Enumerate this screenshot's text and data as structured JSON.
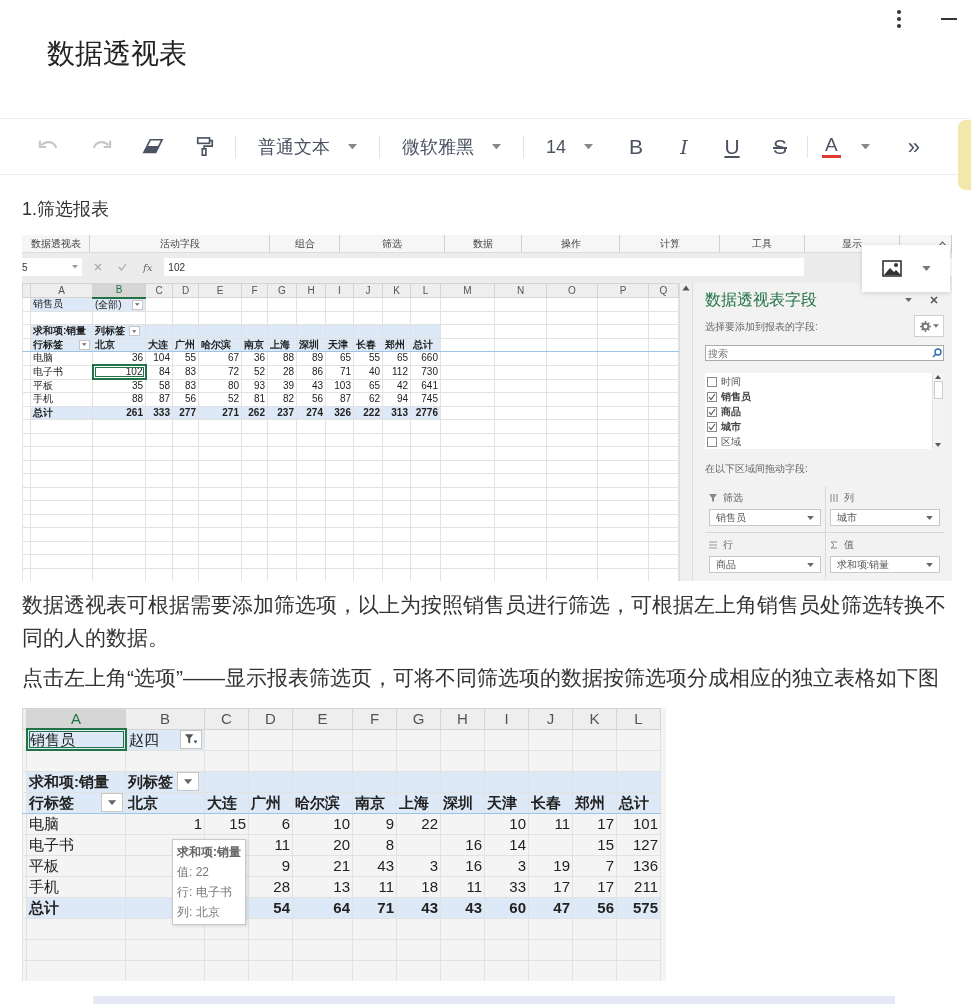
{
  "app": {
    "title": "数据透视表"
  },
  "toolbar": {
    "groups": [
      [
        {
          "kind": "undo",
          "disabled": true
        },
        {
          "kind": "redo",
          "disabled": true
        },
        {
          "kind": "eraser",
          "disabled": false
        },
        {
          "kind": "painter",
          "disabled": false
        }
      ],
      [
        {
          "kind": "select",
          "label": "普通文本"
        }
      ],
      [
        {
          "kind": "select",
          "label": "微软雅黑"
        }
      ],
      [
        {
          "kind": "select",
          "label": "14"
        },
        {
          "kind": "bold",
          "label": "B"
        },
        {
          "kind": "italic",
          "label": "I"
        },
        {
          "kind": "underline",
          "label": "U"
        },
        {
          "kind": "strike",
          "label": "S"
        }
      ],
      [
        {
          "kind": "color",
          "label": "A"
        },
        {
          "kind": "more",
          "label": "»"
        }
      ]
    ]
  },
  "document": {
    "blocks": [
      {
        "kind": "heading",
        "text": "1.筛选报表"
      },
      {
        "kind": "image",
        "sheet": {
          "ribbon": [
            "数据透视表",
            "活动字段",
            "组合",
            "筛选",
            "数据",
            "操作",
            "计算",
            "工具",
            "显示"
          ],
          "name_box": "5",
          "fx": "fx",
          "formula": "102",
          "columns": [
            {
              "label": "A",
              "selected": false
            },
            {
              "label": "B",
              "selected": true
            },
            {
              "label": "C",
              "selected": false
            },
            {
              "label": "D",
              "selected": false
            },
            {
              "label": "E",
              "selected": false
            },
            {
              "label": "F",
              "selected": false
            },
            {
              "label": "G",
              "selected": false
            },
            {
              "label": "H",
              "selected": false
            },
            {
              "label": "I",
              "selected": false
            },
            {
              "label": "J",
              "selected": false
            },
            {
              "label": "K",
              "selected": false
            },
            {
              "label": "L",
              "selected": false
            },
            {
              "label": "M",
              "selected": false
            },
            {
              "label": "N",
              "selected": false
            },
            {
              "label": "O",
              "selected": false
            },
            {
              "label": "P",
              "selected": false
            },
            {
              "label": "Q",
              "selected": false
            }
          ],
          "rows": [
            {
              "kind": "filter",
              "filtered": false,
              "selected": false,
              "cells": [
                "销售员",
                "(全部)"
              ]
            },
            {
              "kind": "blank"
            },
            {
              "kind": "pivot",
              "selected": false,
              "cells": [
                "求和项:销量",
                "列标签"
              ]
            },
            {
              "kind": "header",
              "selected": false,
              "cells": [
                "行标签",
                "北京",
                "大连",
                "广州",
                "哈尔滨",
                "南京",
                "上海",
                "深圳",
                "天津",
                "长春",
                "郑州",
                "总计"
              ]
            },
            {
              "kind": "data",
              "selected": false,
              "cells": [
                "电脑",
                "36",
                "104",
                "55",
                "67",
                "36",
                "88",
                "89",
                "65",
                "55",
                "65",
                "660"
              ]
            },
            {
              "kind": "data",
              "selected": true,
              "cells": [
                "电子书",
                "102",
                "84",
                "83",
                "72",
                "52",
                "28",
                "86",
                "71",
                "40",
                "112",
                "730"
              ]
            },
            {
              "kind": "data",
              "selected": false,
              "cells": [
                "平板",
                "35",
                "58",
                "83",
                "80",
                "93",
                "39",
                "43",
                "103",
                "65",
                "42",
                "641"
              ]
            },
            {
              "kind": "data",
              "selected": false,
              "cells": [
                "手机",
                "88",
                "87",
                "56",
                "52",
                "81",
                "82",
                "56",
                "87",
                "62",
                "94",
                "745"
              ]
            },
            {
              "kind": "total",
              "selected": false,
              "cells": [
                "总计",
                "261",
                "333",
                "277",
                "271",
                "262",
                "237",
                "274",
                "326",
                "222",
                "313",
                "2776"
              ]
            }
          ]
        },
        "panel": {
          "title": "数据透视表字段",
          "subtitle": "选择要添加到报表的字段:",
          "search": {
            "placeholder": "搜索"
          },
          "fields": [
            {
              "label": "时间",
              "checked": false
            },
            {
              "label": "销售员",
              "checked": true
            },
            {
              "label": "商品",
              "checked": true
            },
            {
              "label": "城市",
              "checked": true
            },
            {
              "label": "区域",
              "checked": false
            }
          ],
          "drag_hint": "在以下区域间拖动字段:",
          "areas": [
            {
              "kind": "filter",
              "label": "筛选",
              "value": "销售员"
            },
            {
              "kind": "columns",
              "label": "列",
              "value": "城市"
            },
            {
              "kind": "rows",
              "label": "行",
              "value": "商品"
            },
            {
              "kind": "values",
              "label": "值",
              "value": "求和项:销量"
            }
          ]
        }
      },
      {
        "kind": "paragraph",
        "text": "数据透视表可根据需要添加筛选项，以上为按照销售员进行筛选，可根据左上角销售员处筛选转换不同的人的数据。"
      },
      {
        "kind": "paragraph",
        "text": "点击左上角“选项”——显示报表筛选页，可将不同筛选项的数据按筛选项分成相应的独立表格如下图"
      },
      {
        "kind": "image",
        "sheet": {
          "columns": [
            {
              "label": "A",
              "selected": true
            },
            {
              "label": "B",
              "selected": false
            },
            {
              "label": "C",
              "selected": false
            },
            {
              "label": "D",
              "selected": false
            },
            {
              "label": "E",
              "selected": false
            },
            {
              "label": "F",
              "selected": false
            },
            {
              "label": "G",
              "selected": false
            },
            {
              "label": "H",
              "selected": false
            },
            {
              "label": "I",
              "selected": false
            },
            {
              "label": "J",
              "selected": false
            },
            {
              "label": "K",
              "selected": false
            },
            {
              "label": "L",
              "selected": false
            }
          ],
          "rows": [
            {
              "kind": "filter",
              "filtered": true,
              "selected": true,
              "cells": [
                "销售员",
                "赵四"
              ]
            },
            {
              "kind": "blank"
            },
            {
              "kind": "pivot",
              "selected": false,
              "cells": [
                "求和项:销量",
                "列标签"
              ]
            },
            {
              "kind": "header",
              "selected": false,
              "cells": [
                "行标签",
                "北京",
                "大连",
                "广州",
                "哈尔滨",
                "南京",
                "上海",
                "深圳",
                "天津",
                "长春",
                "郑州",
                "总计"
              ]
            },
            {
              "kind": "data",
              "selected": false,
              "cells": [
                "电脑",
                "1",
                "15",
                "6",
                "10",
                "9",
                "22",
                null,
                "10",
                "11",
                "17",
                "101"
              ]
            },
            {
              "kind": "data",
              "selected": false,
              "cells": [
                "电子书",
                null,
                null,
                "11",
                "20",
                "8",
                null,
                "16",
                "14",
                null,
                "15",
                "127"
              ]
            },
            {
              "kind": "data",
              "selected": false,
              "cells": [
                "平板",
                null,
                null,
                "9",
                "21",
                "43",
                "3",
                "16",
                "3",
                "19",
                "7",
                "136"
              ]
            },
            {
              "kind": "data",
              "selected": false,
              "cells": [
                "手机",
                null,
                null,
                "28",
                "13",
                "11",
                "18",
                "11",
                "33",
                "17",
                "17",
                "211"
              ]
            },
            {
              "kind": "total",
              "selected": false,
              "cells": [
                "总计",
                null,
                null,
                "54",
                "64",
                "71",
                "43",
                "43",
                "60",
                "47",
                "56",
                "575"
              ]
            }
          ]
        },
        "tooltip": {
          "title": "求和项:销量",
          "lines": [
            "值: 22",
            "行: 电子书",
            "列: 北京"
          ]
        }
      }
    ]
  }
}
